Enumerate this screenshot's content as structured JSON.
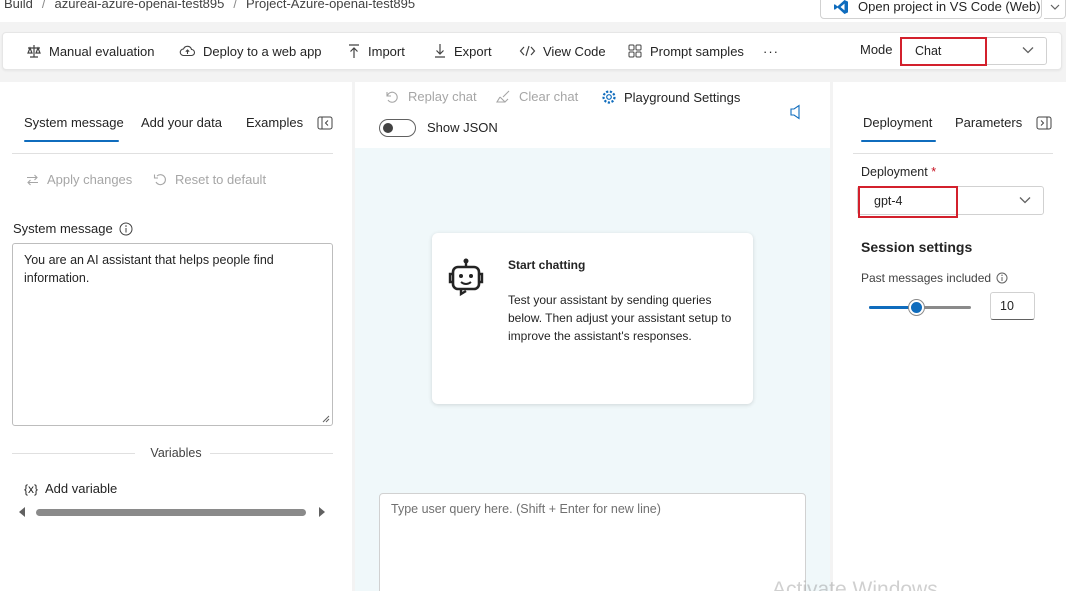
{
  "breadcrumb": [
    "Build",
    "azureai-azure-openai-test895",
    "Project-Azure-openai-test895"
  ],
  "vscode_button": "Open project in VS Code (Web)",
  "toolbar": {
    "manual_evaluation": "Manual evaluation",
    "deploy": "Deploy to a web app",
    "import": "Import",
    "export": "Export",
    "view_code": "View Code",
    "prompt_samples": "Prompt samples",
    "more": "···",
    "mode_label": "Mode",
    "mode_value": "Chat"
  },
  "left": {
    "tabs": [
      "System message",
      "Add your data",
      "Examples"
    ],
    "apply_changes": "Apply changes",
    "reset_default": "Reset to default",
    "system_message_label": "System message",
    "system_message_text": "You are an AI assistant that helps people find information.",
    "variables_title": "Variables",
    "add_variable": "Add variable"
  },
  "center": {
    "replay_chat": "Replay chat",
    "clear_chat": "Clear chat",
    "playground_settings": "Playground Settings",
    "show_json": "Show JSON",
    "show_json_on": false,
    "card_title": "Start chatting",
    "card_body": "Test your assistant by sending queries below. Then adjust your assistant setup to improve the assistant's responses.",
    "query_placeholder": "Type user query here. (Shift + Enter for new line)"
  },
  "right": {
    "tabs": [
      "Deployment",
      "Parameters"
    ],
    "deployment_label": "Deployment",
    "required_mark": "*",
    "deployment_value": "gpt-4",
    "session_settings": "Session settings",
    "past_messages_label": "Past messages included",
    "past_messages_value": "10",
    "past_messages_slider_fraction": 0.46
  },
  "watermark": "Activate Windows",
  "colors": {
    "accent": "#0f6cbd",
    "highlight": "#d3202c"
  }
}
